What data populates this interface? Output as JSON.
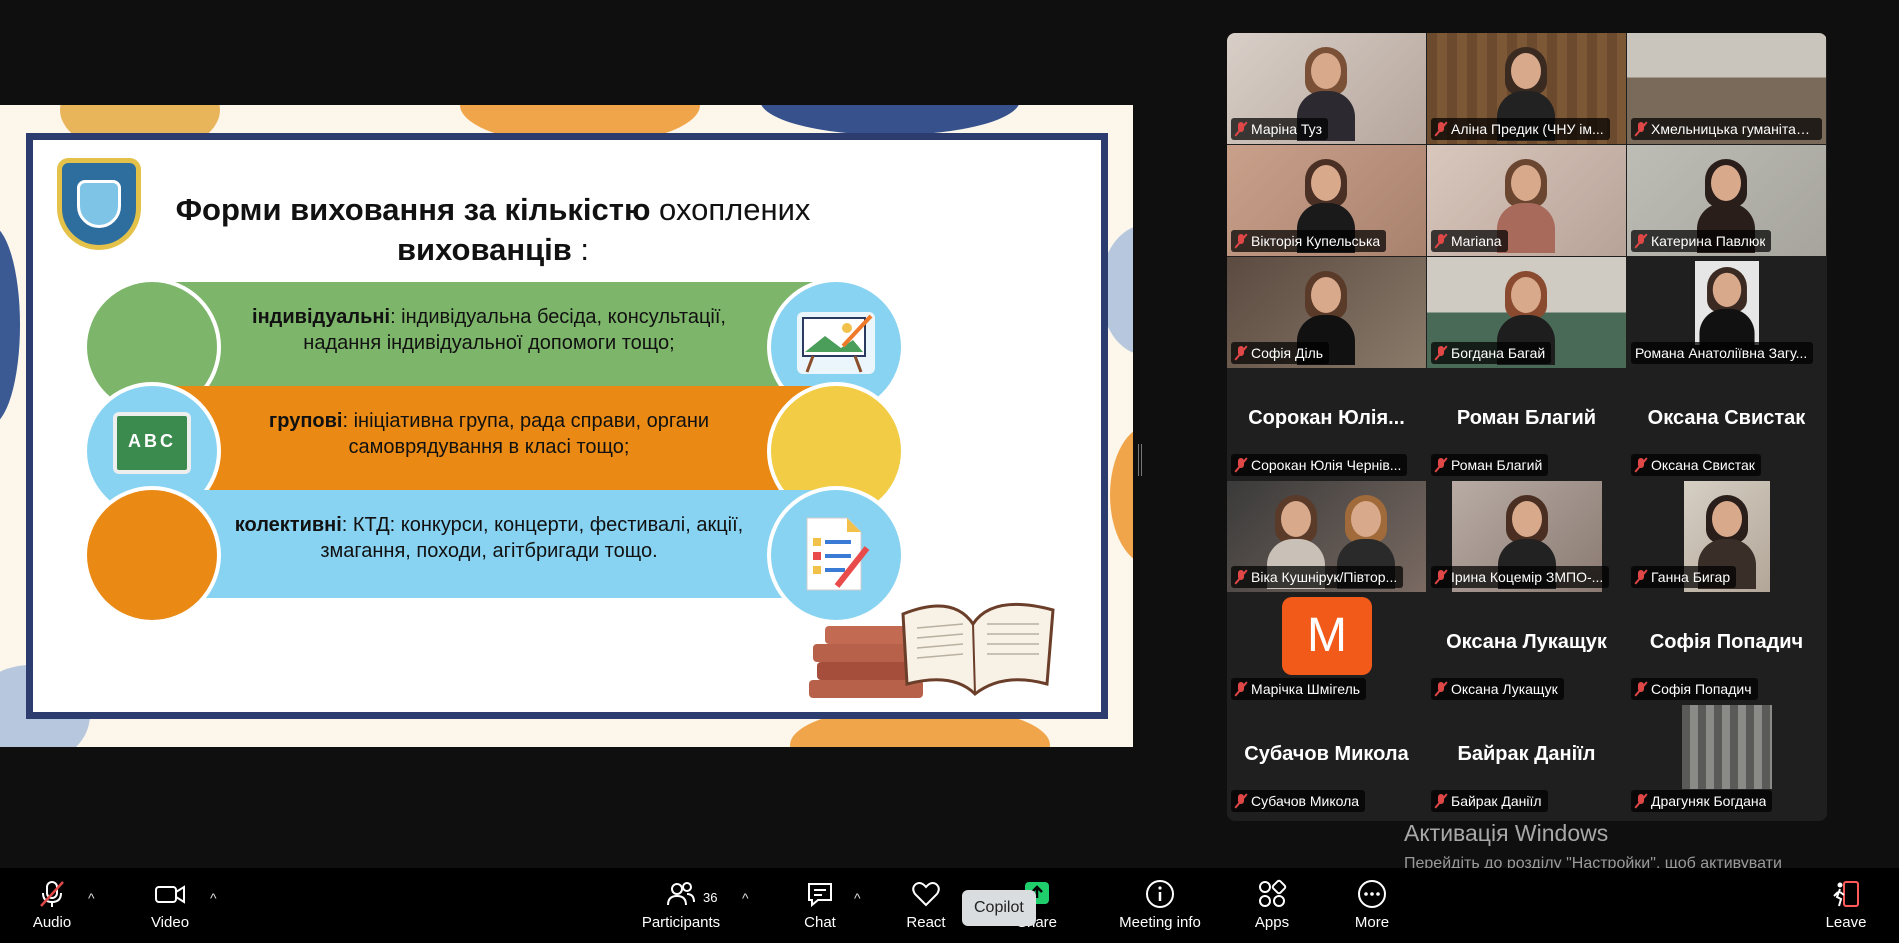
{
  "slide": {
    "title_bold": "Форми виховання за кількістю",
    "title_rest": " охоплених",
    "title_line2": "вихованців",
    "title_colon": " :",
    "bands": [
      {
        "bold": "індивідуальні",
        "text": ": індивідуальна бесіда, консультації, надання індивідуальної допомоги тощо;"
      },
      {
        "bold": "групові",
        "text": ": ініціативна група, рада справи, органи самоврядування в класі тощо;"
      },
      {
        "bold": "колективні",
        "text": ": КТД: конкурси, концерти, фестивалі, акції, змагання, походи, агітбригади тощо."
      }
    ],
    "board_text": "ABC"
  },
  "gallery": {
    "tiles": [
      {
        "name": "Маріна Туз"
      },
      {
        "name": "Аліна Предик (ЧНУ ім..."
      },
      {
        "name": "Хмельницька гуманітарн..."
      },
      {
        "name": "Вікторія Купельська"
      },
      {
        "name": "Mariana"
      },
      {
        "name": "Катерина Павлюк"
      },
      {
        "name": "Софія Діль"
      },
      {
        "name": "Богдана Багай"
      },
      {
        "name": "Романа Анатоліївна Загу..."
      },
      {
        "name": "Сорокан Юлія Чернів...",
        "heading": "Сорокан Юлія..."
      },
      {
        "name": "Роман Благий",
        "heading": "Роман Благий"
      },
      {
        "name": "Оксана Свистак",
        "heading": "Оксана Свистак"
      },
      {
        "name": "Віка Кушнірук/Півтор..."
      },
      {
        "name": "Ірина Коцемір ЗМПО-..."
      },
      {
        "name": "Ганна Бигар"
      },
      {
        "name": "Марічка Шмігель",
        "avatar_letter": "M"
      },
      {
        "name": "Оксана Лукащук",
        "heading": "Оксана Лукащук"
      },
      {
        "name": "Софія Попадич",
        "heading": "Софія Попадич"
      },
      {
        "name": "Субачов Микола",
        "heading": "Субачов Микола"
      },
      {
        "name": "Байрак Даніїл",
        "heading": "Байрак Даніїл"
      },
      {
        "name": "Драгуняк Богдана"
      }
    ]
  },
  "watermark": {
    "title": "Активація Windows",
    "subtitle": "Перейдіть до розділу \"Настройки\", щоб активувати Windows."
  },
  "toolbar": {
    "audio": "Audio",
    "video": "Video",
    "participants": "Participants",
    "participants_count": "36",
    "chat": "Chat",
    "react": "React",
    "share": "Share",
    "copilot": "Copilot",
    "meeting_info": "Meeting info",
    "apps": "Apps",
    "more": "More",
    "leave": "Leave"
  },
  "colors": {
    "band_green": "#7db56a",
    "band_orange": "#ea8a14",
    "band_blue": "#89d3f2",
    "active_speaker": "#2ed47a",
    "avatar_orange": "#f25a1a"
  }
}
